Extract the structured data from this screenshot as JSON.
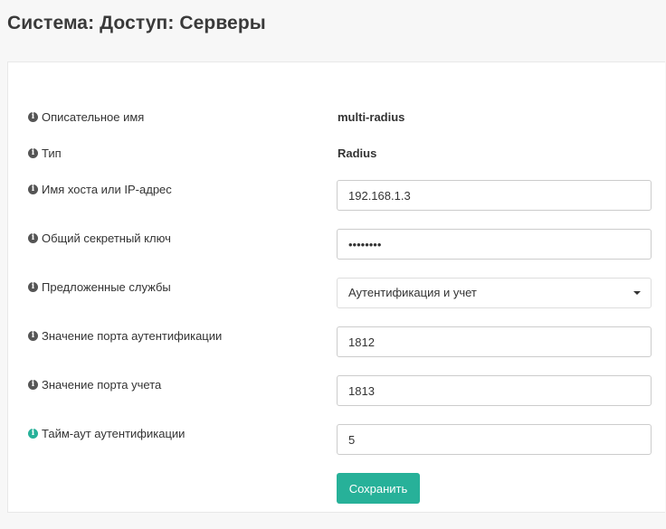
{
  "page": {
    "title": "Система: Доступ: Серверы"
  },
  "form": {
    "descriptive_name": {
      "label": "Описательное имя",
      "value": "multi-radius"
    },
    "type": {
      "label": "Тип",
      "value": "Radius"
    },
    "hostname": {
      "label": "Имя хоста или IP-адрес",
      "value": "192.168.1.3"
    },
    "shared_secret": {
      "label": "Общий секретный ключ",
      "value": "••••••••"
    },
    "services": {
      "label": "Предложенные службы",
      "selected": "Аутентификация и учет"
    },
    "auth_port": {
      "label": "Значение порта аутентификации",
      "value": "1812"
    },
    "acct_port": {
      "label": "Значение порта учета",
      "value": "1813"
    },
    "auth_timeout": {
      "label": "Тайм-аут аутентификации",
      "value": "5"
    },
    "save_label": "Сохранить"
  },
  "icons": {
    "info": "info-circle-icon",
    "dropdown": "caret-down-icon"
  },
  "colors": {
    "accent": "#27b199",
    "text": "#333333",
    "background": "#f7f7f7"
  }
}
